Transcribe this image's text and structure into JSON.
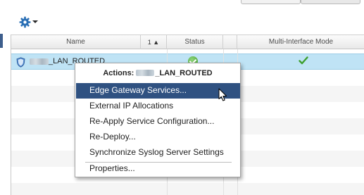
{
  "grid": {
    "columns": [
      {
        "label": "Name"
      },
      {
        "label": "1 ▲"
      },
      {
        "label": "Status"
      },
      {
        "label": ""
      },
      {
        "label": "Multi-Interface Mode"
      }
    ],
    "rows": [
      {
        "name_suffix": "_LAN_ROUTED",
        "status": "ok",
        "multi_interface_mode": true
      }
    ]
  },
  "context_menu": {
    "title_prefix": "Actions:",
    "title_suffix": "_LAN_ROUTED",
    "items": [
      {
        "label": "Edge Gateway Services...",
        "highlighted": true
      },
      {
        "label": "External IP Allocations"
      },
      {
        "label": "Re-Apply Service Configuration..."
      },
      {
        "label": "Re-Deploy..."
      },
      {
        "label": "Synchronize Syslog Server Settings"
      },
      {
        "label": "Properties..."
      }
    ]
  },
  "colors": {
    "selection_row": "#bfe3f5",
    "menu_highlight": "#2f5181",
    "status_green": "#3d9b2b"
  },
  "icons": {
    "toolbar": "gear-icon",
    "row": "shield-icon",
    "status": "check-circle-icon",
    "multi_interface": "checkmark-icon"
  }
}
